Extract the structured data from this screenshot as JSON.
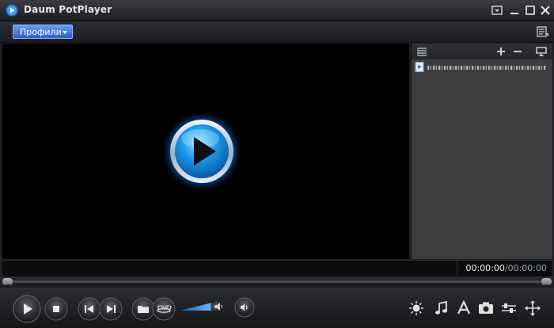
{
  "window": {
    "title": "Daum PotPlayer"
  },
  "toolbar": {
    "profile_label": "Профили"
  },
  "status": {
    "time_current": "00:00:00",
    "time_separator": "/",
    "time_total": "00:00:00"
  },
  "volume": {
    "level": 0.8
  },
  "colors": {
    "accent_blue": "#2a7fe0",
    "profile_button": "#3c6fd8",
    "background": "#000000",
    "playlist_bg": "#3b3c3e"
  },
  "icons": {
    "title": [
      "potplayer-logo-icon",
      "menu-icon",
      "minimize-icon",
      "maximize-icon",
      "close-icon"
    ],
    "playlist": [
      "playlist-list-icon",
      "add-icon",
      "remove-icon",
      "playlist-output-icon"
    ],
    "controls": [
      "play-icon",
      "stop-icon",
      "previous-icon",
      "next-icon",
      "open-folder-icon",
      "dvd-icon",
      "speaker-icon",
      "audio-toggle-icon",
      "brightness-icon",
      "music-note-icon",
      "subtitle-icon",
      "camera-icon",
      "equalizer-icon",
      "move-icon"
    ]
  }
}
